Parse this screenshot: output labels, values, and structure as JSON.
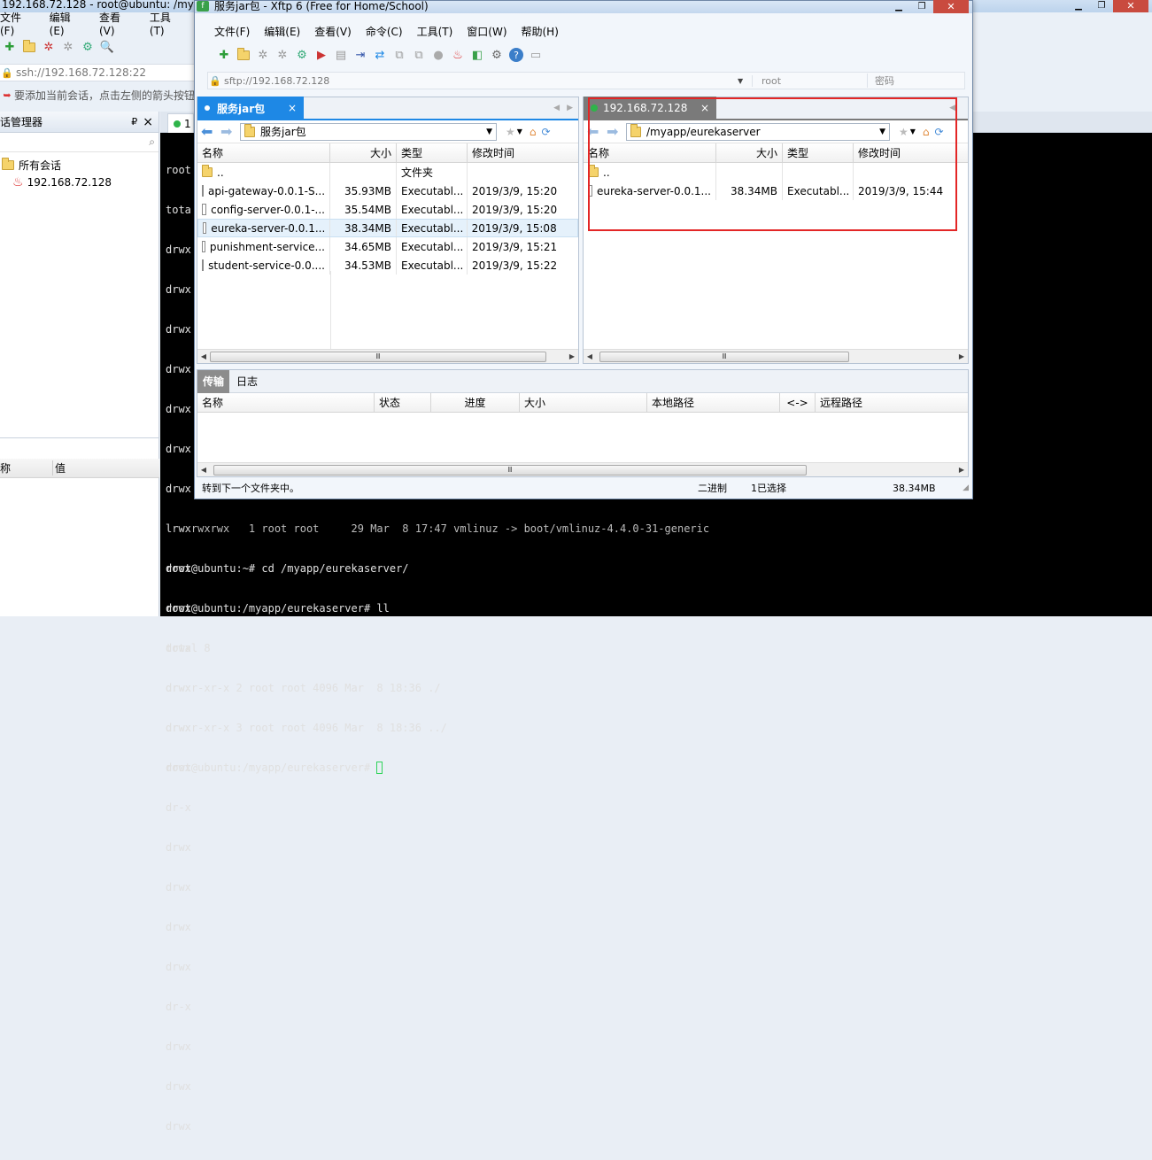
{
  "xshell": {
    "title": "192.168.72.128 - root@ubuntu: /mya",
    "menu": [
      "文件(F)",
      "编辑(E)",
      "查看(V)",
      "工具(T)"
    ],
    "address": "ssh://192.168.72.128:22",
    "hint": "要添加当前会话，点击左侧的箭头按钮",
    "session_manager": "话管理器",
    "pin": "ₐ",
    "close": "×",
    "tree_root": "所有会话",
    "tree_child": "192.168.72.128",
    "props_name": "称",
    "props_value": "值",
    "tab_label": "1"
  },
  "terminal": {
    "left_lines": [
      "root",
      "tota",
      "drwx",
      "drwx",
      "drwx",
      "drwx",
      "drwx",
      "drwx",
      "drwx",
      "lrwx",
      "drwx",
      "drwx",
      "drwx",
      "drwx",
      "drwx",
      "drwx",
      "dr-x",
      "drwx",
      "drwx",
      "drwx",
      "drwx",
      "dr-x",
      "drwx",
      "drwx",
      "drwx"
    ],
    "partial_line": "lrwxrwxrwx   1 root root     29 Mar  8 17:47 vmlinuz -> boot/vmlinuz-4.4.0-31-generic",
    "lines": [
      "root@ubuntu:~# cd /myapp/eurekaserver/",
      "root@ubuntu:/myapp/eurekaserver# ll",
      "total 8",
      "drwxr-xr-x 2 root root 4096 Mar  8 18:36 ./",
      "drwxr-xr-x 3 root root 4096 Mar  8 18:36 ../"
    ],
    "prompt": "root@ubuntu:/myapp/eurekaserver# "
  },
  "xftp": {
    "title": "服务jar包 - Xftp 6 (Free for Home/School)",
    "menu": [
      "文件(F)",
      "编辑(E)",
      "查看(V)",
      "命令(C)",
      "工具(T)",
      "窗口(W)",
      "帮助(H)"
    ],
    "address": "sftp://192.168.72.128",
    "user": "root",
    "password_placeholder": "密码",
    "left_tab": "服务jar包",
    "right_tab": "192.168.72.128",
    "tab_close": "×",
    "left_path": "服务jar包",
    "right_path": "/myapp/eurekaserver",
    "col_name": "名称",
    "col_size": "大小",
    "col_type": "类型",
    "col_mtime": "修改时间",
    "left_files": [
      {
        "name": "..",
        "size": "",
        "type": "文件夹",
        "mtime": ""
      },
      {
        "name": "api-gateway-0.0.1-S...",
        "size": "35.93MB",
        "type": "Executabl...",
        "mtime": "2019/3/9, 15:20"
      },
      {
        "name": "config-server-0.0.1-...",
        "size": "35.54MB",
        "type": "Executabl...",
        "mtime": "2019/3/9, 15:20"
      },
      {
        "name": "eureka-server-0.0.1...",
        "size": "38.34MB",
        "type": "Executabl...",
        "mtime": "2019/3/9, 15:08"
      },
      {
        "name": "punishment-service...",
        "size": "34.65MB",
        "type": "Executabl...",
        "mtime": "2019/3/9, 15:21"
      },
      {
        "name": "student-service-0.0....",
        "size": "34.53MB",
        "type": "Executabl...",
        "mtime": "2019/3/9, 15:22"
      }
    ],
    "right_files": [
      {
        "name": "..",
        "size": "",
        "type": "",
        "mtime": ""
      },
      {
        "name": "eureka-server-0.0.1...",
        "size": "38.34MB",
        "type": "Executabl...",
        "mtime": "2019/3/9, 15:44"
      }
    ],
    "transfer_tab": "传输",
    "log_tab": "日志",
    "transfer_cols": [
      "名称",
      "状态",
      "进度",
      "大小",
      "本地路径",
      "<->",
      "远程路径"
    ],
    "status_text": "转到下一个文件夹中。",
    "status_mode": "二进制",
    "status_selected": "1已选择",
    "status_size": "38.34MB"
  },
  "colors": {
    "accent": "#1e88e5",
    "highlight": "#e32626",
    "terminal_bg": "#000000"
  }
}
